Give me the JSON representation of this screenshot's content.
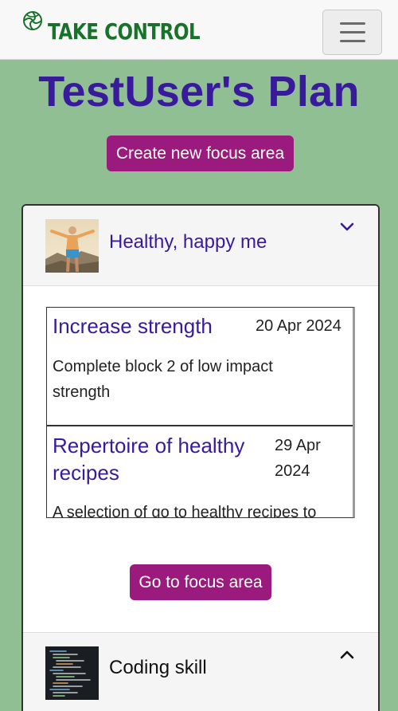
{
  "brand": {
    "name": "TAKE CONTROL",
    "color": "#18732a"
  },
  "page": {
    "title": "TestUser's Plan",
    "create_button": "Create new focus area"
  },
  "focus_areas": [
    {
      "label": "Healthy, happy me",
      "expanded": true,
      "goals": [
        {
          "title": "Increase strength",
          "date": "20 Apr 2024",
          "description": "Complete block 2 of low impact strength"
        },
        {
          "title_line1": "Repertoire of healthy",
          "title_line2": "recipes",
          "date_line1": "29 Apr",
          "date_line2": "2024",
          "description": "A selection of go to healthy recipes to"
        }
      ],
      "goto_button": "Go to focus area"
    },
    {
      "label": "Coding skill",
      "expanded": false
    }
  ],
  "colors": {
    "background": "#8fbf92",
    "accent_button": "#9b1a7d",
    "heading": "#3a1a9c"
  },
  "icons": {
    "brand": "brand-logo-icon",
    "menu": "hamburger-menu-icon",
    "collapse": "chevron-down-icon",
    "expand": "chevron-up-icon"
  }
}
